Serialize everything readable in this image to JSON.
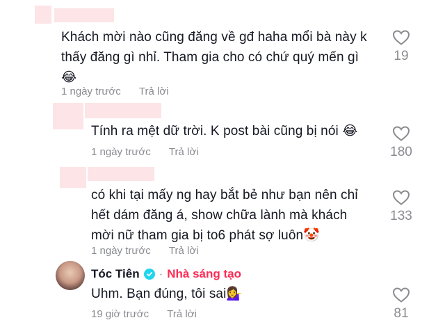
{
  "comments": [
    {
      "text_lines": [
        "Khách mời nào cũng đăng về gđ haha mổi bà này k",
        "thấy đăng gì nhỉ. Tham gia cho có chứ quý mến gì"
      ],
      "emoji": "😂",
      "time": "1 ngày trước",
      "reply_label": "Trả lời",
      "likes": "19"
    },
    {
      "text_lines": [
        "Tính ra mệt dữ trời. K post bài cũng bị nói"
      ],
      "emoji": "😂",
      "time": "1 ngày trước",
      "reply_label": "Trả lời",
      "likes": "180"
    },
    {
      "text_lines": [
        "có khi tại mấy ng hay bắt bẻ như bạn nên chỉ",
        "hết dám đăng á, show chữa lành mà khách",
        "mời nữ tham gia bị to6 phát sợ luôn"
      ],
      "emoji": "🤡",
      "time": "1 ngày trước",
      "reply_label": "Trả lời",
      "likes": "133"
    },
    {
      "author": "Tóc Tiên",
      "badge": "Nhà sáng tạo",
      "text_lines": [
        "Uhm. Bạn đúng, tôi sai"
      ],
      "emoji": "💁‍♀️",
      "time": "19 giờ trước",
      "reply_label": "Trả lời",
      "likes": "81"
    }
  ],
  "colors": {
    "accent": "#fe2c55",
    "verified": "#20d5ec",
    "muted": "#8a8b91",
    "redaction": "#fde4e6"
  }
}
